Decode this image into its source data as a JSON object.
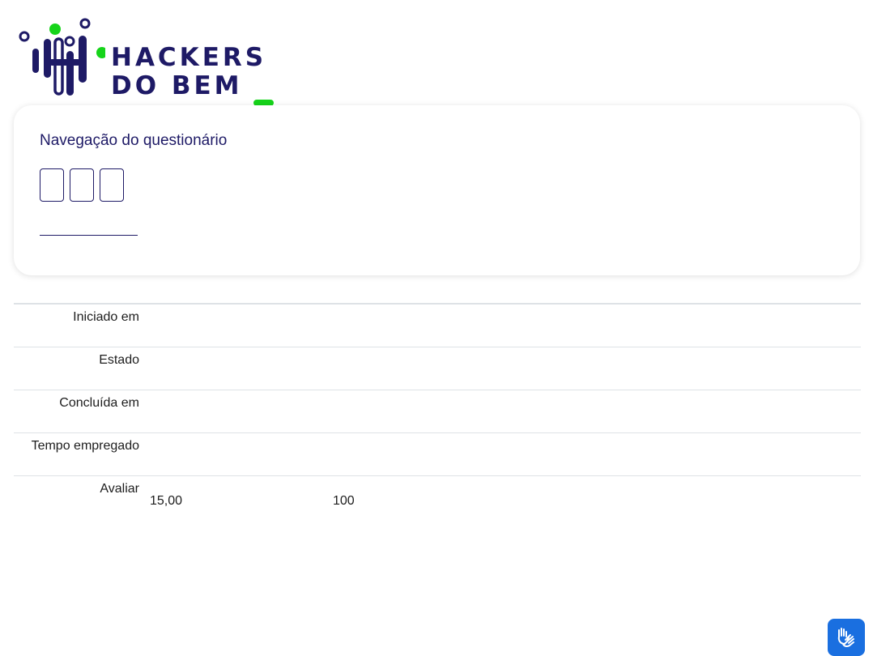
{
  "logo": {
    "line1": "HACKERS",
    "line2": "DO BEM"
  },
  "quiz_navigation": {
    "title": "Navegação do questionário",
    "questions": [
      "",
      "",
      ""
    ],
    "finish_link": ""
  },
  "summary": {
    "rows": [
      {
        "label": "Iniciado em",
        "value": ""
      },
      {
        "label": "Estado",
        "value": ""
      },
      {
        "label": "Concluída em",
        "value": ""
      },
      {
        "label": "Tempo empregado",
        "value": ""
      }
    ],
    "grade": {
      "label": "Avaliar",
      "score": "15,00",
      "max": "100"
    }
  },
  "accessibility": {
    "icon": "sign-language-hands-icon"
  },
  "colors": {
    "brand_navy": "#1e1a66",
    "brand_green": "#16d41a",
    "access_blue": "#1a6fe0"
  }
}
